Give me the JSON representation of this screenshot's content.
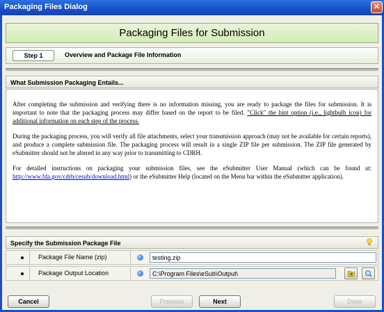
{
  "window": {
    "title": "Packaging Files Dialog",
    "close_glyph": "✕"
  },
  "header": {
    "title": "Packaging Files for Submission"
  },
  "step": {
    "pill": "Step 1",
    "label": "Overview and Package File Information"
  },
  "overview": {
    "heading": "What Submission Packaging Entails...",
    "p1_text": "After completing the submission and verifying there is no information missing, you are ready to package the files for submission. It is important to note that the packaging process may differ based on the report to be filed. ",
    "p1_hint": "\"Click\" the hint option (i.e., lightbulb icon) for additional information on each step of the process.",
    "p2": "During the packaging process, you will verify all file attachments, select your transmission approach (may not be available for certain reports), and produce a complete submission file. The packaging process will result in a single ZIP file per submission. The ZIP file generated by eSubmitter should not be altered in any way prior to transmitting to CDRH.",
    "p3_before": "For detailed instructions on packaging your submission files, see the eSubmitter User Manual (which can be found at: ",
    "p3_link": "http://www.fda.gov/cdrh/cesub/download.html",
    "p3_after": ") or the eSubmitter Help (located on the Menu bar within the eSubmitter application)."
  },
  "package": {
    "heading": "Specify the Submission Package File",
    "hint_icon": "lightbulb-icon",
    "rows": [
      {
        "label": "Package File Name (zip)",
        "value": "testing.zip"
      },
      {
        "label": "Package Output Location",
        "value": "C:\\Program Files\\eSub\\Output\\"
      }
    ]
  },
  "buttons": {
    "cancel": "Cancel",
    "previous": "Previous",
    "next": "Next",
    "done": "Done"
  },
  "colors": {
    "titlebar": "#1750c8",
    "header_bg": "#d4ecb8",
    "required_dot": "#1c5fd6",
    "link": "#0000cc"
  }
}
